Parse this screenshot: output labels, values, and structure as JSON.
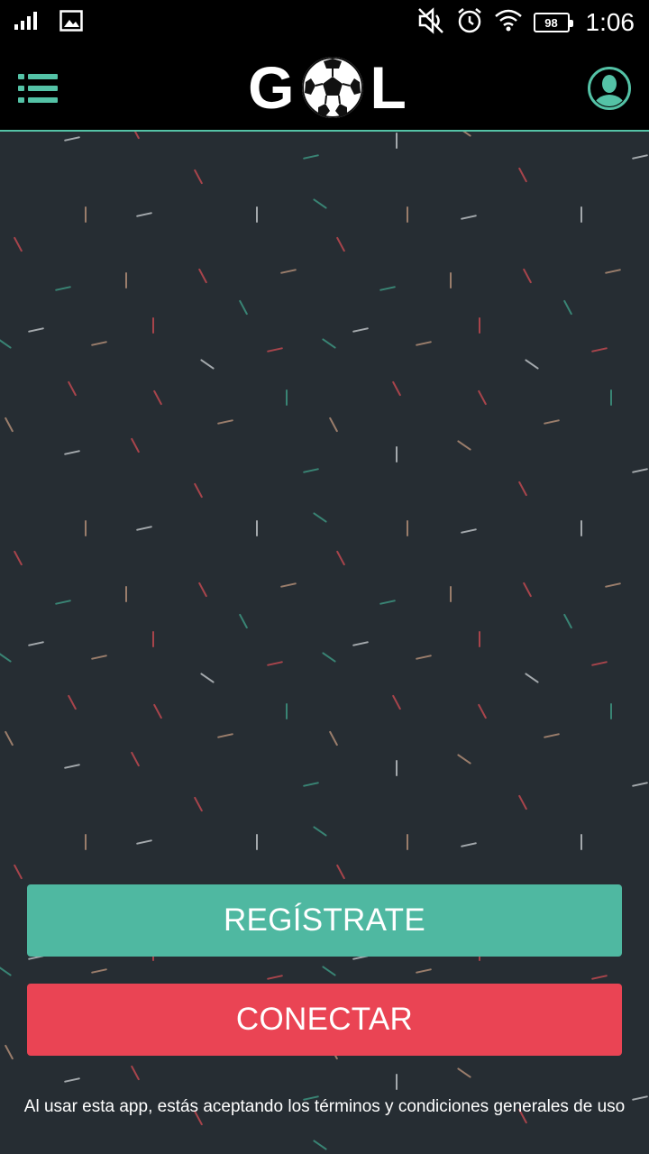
{
  "status_bar": {
    "time": "1:06",
    "battery": "98",
    "icons": [
      "signal-icon",
      "image-notification-icon",
      "mute-icon",
      "alarm-icon",
      "wifi-icon",
      "battery-icon"
    ]
  },
  "app_bar": {
    "logo_left": "G",
    "logo_right": "L",
    "menu_icon": "menu-icon",
    "profile_icon": "profile-icon"
  },
  "actions": {
    "register_label": "REGÍSTRATE",
    "connect_label": "CONECTAR"
  },
  "footer": {
    "terms_text": "Al usar esta app, estás aceptando los términos y condiciones generales de uso"
  },
  "colors": {
    "accent": "#54c2a6",
    "register": "#4fb8a1",
    "connect": "#ea4454",
    "background": "#262d33",
    "confetti": [
      "#c4c9cc",
      "#c84a52",
      "#3e9a85",
      "#b8917a"
    ]
  }
}
